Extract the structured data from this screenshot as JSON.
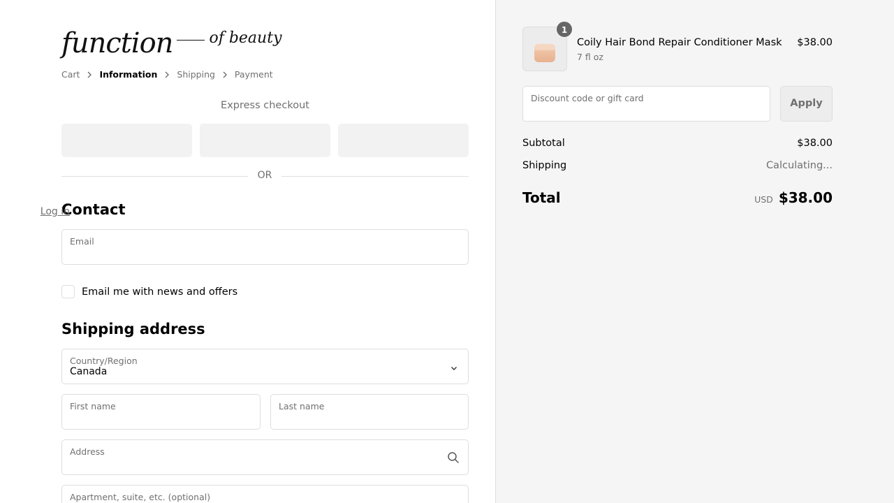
{
  "logo": {
    "main": "function",
    "sub": "of beauty"
  },
  "breadcrumb": [
    {
      "label": "Cart"
    },
    {
      "label": "Information"
    },
    {
      "label": "Shipping"
    },
    {
      "label": "Payment"
    }
  ],
  "express": {
    "title": "Express checkout",
    "or_label": "OR"
  },
  "contact": {
    "title": "Contact",
    "login_label": "Log in",
    "email_label": "Email",
    "newsletter_label": "Email me with news and offers"
  },
  "shipping": {
    "title": "Shipping address",
    "country_label": "Country/Region",
    "country_value": "Canada",
    "first_name_label": "First name",
    "last_name_label": "Last name",
    "address_label": "Address",
    "apartment_label": "Apartment, suite, etc. (optional)"
  },
  "order": {
    "item": {
      "name": "Coily Hair Bond Repair Conditioner Mask",
      "variant": "7 fl oz",
      "price": "$38.00",
      "quantity": "1"
    },
    "discount_placeholder": "Discount code or gift card",
    "apply_label": "Apply",
    "subtotal_label": "Subtotal",
    "subtotal_value": "$38.00",
    "shipping_label": "Shipping",
    "shipping_value": "Calculating...",
    "total_label": "Total",
    "currency": "USD",
    "total_value": "$38.00"
  },
  "colors": {
    "muted_text": "#707070",
    "border": "#dedede",
    "aside_bg": "#f5f5f5",
    "badge": "#666666"
  }
}
